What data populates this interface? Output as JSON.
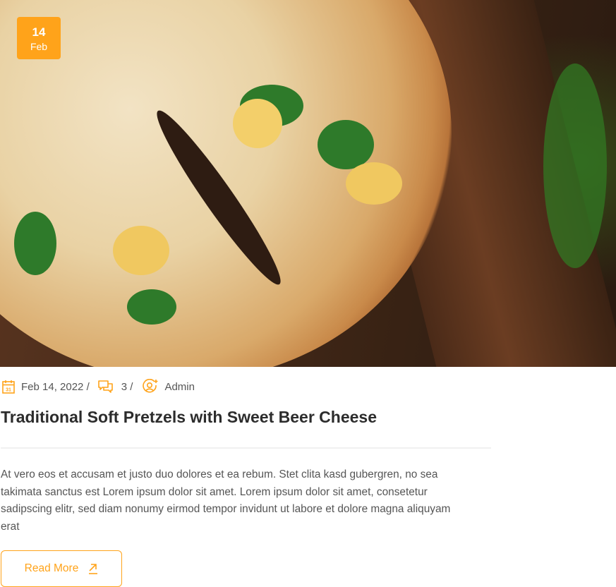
{
  "post": {
    "date_badge": {
      "day": "14",
      "month": "Feb"
    },
    "meta": {
      "date": "Feb 14, 2022 /",
      "comments": "3 /",
      "author": "Admin"
    },
    "title": "Traditional Soft Pretzels with Sweet Beer Cheese",
    "excerpt": "At vero eos et accusam et justo duo dolores et ea rebum. Stet clita kasd gubergren, no sea takimata sanctus est Lorem ipsum dolor sit amet. Lorem ipsum dolor sit amet, consetetur sadipscing elitr, sed diam nonumy eirmod tempor invidunt ut labore et dolore magna aliquyam erat",
    "read_more": "Read More"
  },
  "colors": {
    "accent": "#ffa31a"
  }
}
